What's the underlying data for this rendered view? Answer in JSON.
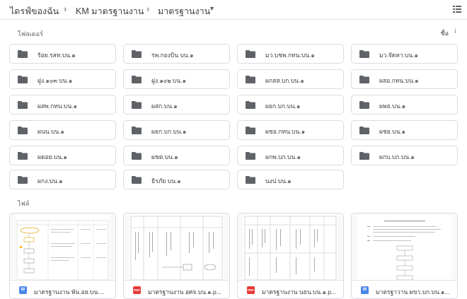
{
  "breadcrumb": {
    "items": [
      "ไดรฟ์ของฉัน",
      "KM มาตรฐานงาน",
      "มาตรฐานงาน"
    ],
    "separator": "›"
  },
  "sections": {
    "folders_label": "โฟลเดอร์",
    "files_label": "ไฟล์",
    "sort_label": "ชื่อ"
  },
  "folders": [
    "ร้อย.รสท.บน.๑",
    "รพ.กองบิน บน.๑",
    "มว.บชพ.กทน.บน.๑",
    "มว.จัดหา.บน.๑",
    "ฝูง.๑๐๓ บน.๑",
    "ฝูง.๑๐๒ บน.๑",
    "ผกสส.บก.บน.๑",
    "ผสอ.กทน.บน.๑",
    "ผสพ.กทน.บน.๑",
    "ผสก.บน.๑",
    "ผยก.บก.บน.๑",
    "ผพธ.บน.๑",
    "ผนน.บน.๑",
    "ผยก.บก.บน.๑",
    "ผชอ.กทน.บน.๑",
    "ผชย.บน.๑",
    "ผตอย.บน.๑",
    "ผชต.บน.๑",
    "ผกพ.บก.บน.๑",
    "ผกบ.บก.บน.๑",
    "ผกง.บน.๑",
    "ธิรภัย บน.๑",
    "นงป.บน.๑"
  ],
  "files": [
    {
      "name": "มาตรฐานงาน พัน.อย.บน....",
      "type": "W"
    },
    {
      "name": "มาตรฐานงาน อศจ.บน.๑.p...",
      "type": "PDF"
    },
    {
      "name": "มาตรฐานงาน นธน.บน.๑.p...",
      "type": "PDF"
    },
    {
      "name": "มาตรฐาวาน ผขว.บก.บน.๑...",
      "type": "W"
    }
  ],
  "icons": {
    "folder": "folder-icon",
    "dropdown": "chevron-down-icon",
    "sort_direction": "arrow-down-icon",
    "view_toggle": "list-view-icon"
  },
  "colors": {
    "folder_icon": "#5f6368",
    "word_badge": "#4a86e8",
    "pdf_badge": "#e53935",
    "border": "#dadce0"
  }
}
